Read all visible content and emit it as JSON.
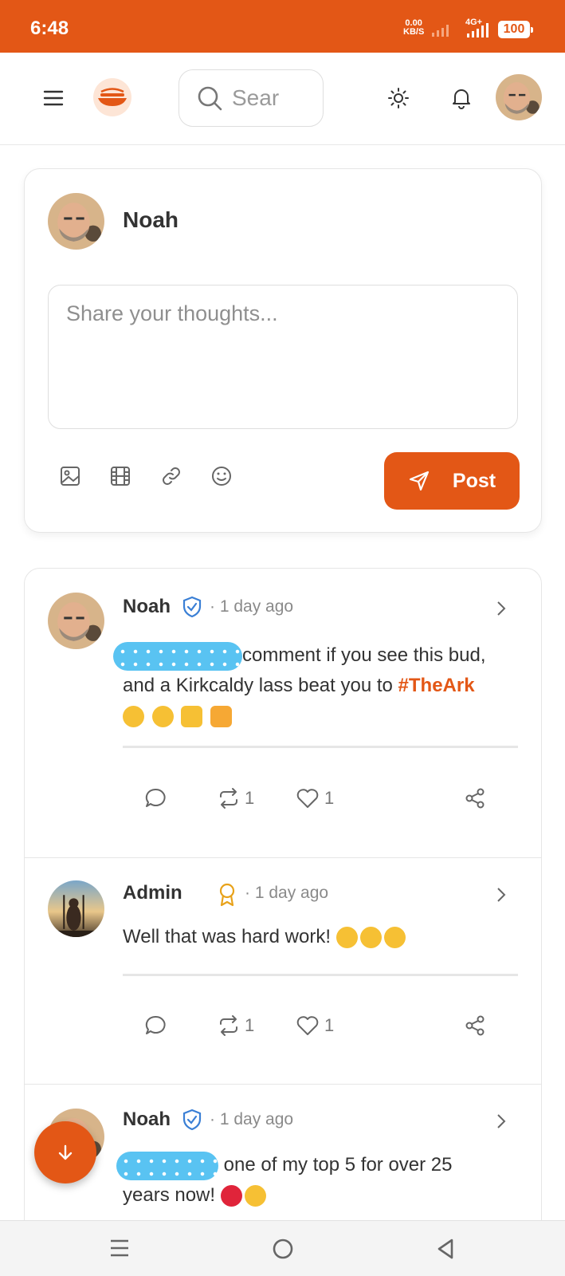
{
  "status_bar": {
    "time": "6:48",
    "speed_value": "0.00",
    "speed_unit": "KB/S",
    "network": "4G+",
    "battery": "100"
  },
  "header": {
    "search_placeholder": "Sear"
  },
  "composer": {
    "user_name": "Noah",
    "placeholder": "Share your thoughts...",
    "post_label": "Post"
  },
  "posts": [
    {
      "author": "Noah",
      "time": "· 1 day ago",
      "text_line1": "comment if you see this bud,",
      "text_line2": "and a Kirkcaldy lass beat you to ",
      "hashtag": "#TheArk",
      "reposts": "1",
      "likes": "1"
    },
    {
      "author": "Admin",
      "time": "· 1 day ago",
      "text": "Well that was hard work! ",
      "reposts": "1",
      "likes": "1"
    },
    {
      "author": "Noah",
      "time": "· 1 day ago",
      "text_line1": " one of my top 5 for over 25",
      "text_line2": "years now! "
    }
  ],
  "colors": {
    "accent": "#e35716",
    "verified": "#3a7fd5",
    "award": "#e8a21a",
    "redaction": "#59c3f2"
  }
}
